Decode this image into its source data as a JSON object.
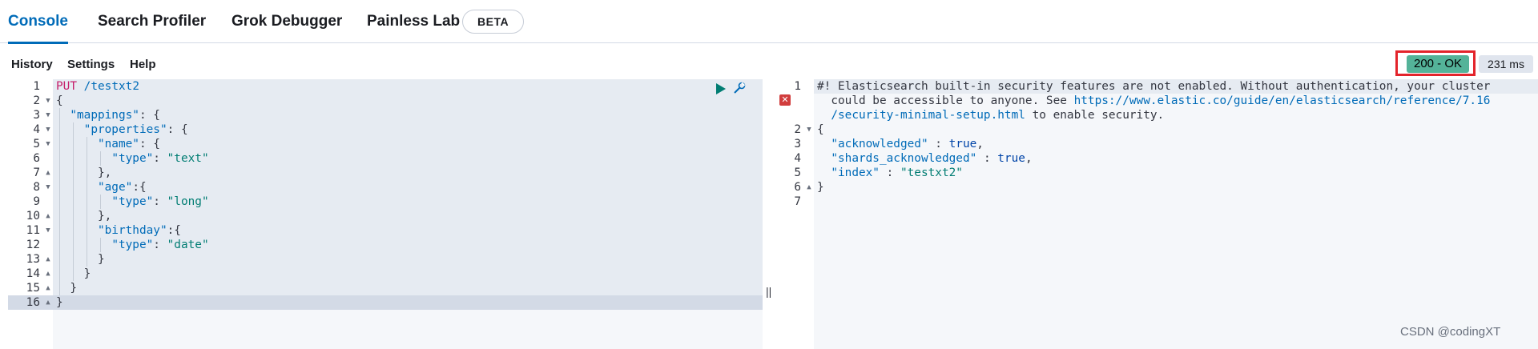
{
  "tabs": [
    {
      "label": "Console",
      "active": true
    },
    {
      "label": "Search Profiler",
      "active": false
    },
    {
      "label": "Grok Debugger",
      "active": false
    },
    {
      "label": "Painless Lab",
      "active": false
    }
  ],
  "beta_badge": "BETA",
  "toolbar": {
    "history": "History",
    "settings": "Settings",
    "help": "Help"
  },
  "response_status": {
    "status": "200 - OK",
    "status_color": "#54b399",
    "time": "231 ms"
  },
  "request_editor": {
    "line_numbers": [
      "1",
      "2",
      "3",
      "4",
      "5",
      "6",
      "7",
      "8",
      "9",
      "10",
      "11",
      "12",
      "13",
      "14",
      "15",
      "16"
    ],
    "lines": [
      "PUT /testxt2",
      "{",
      "  \"mappings\": {",
      "    \"properties\": {",
      "      \"name\": {",
      "        \"type\": \"text\"",
      "      },",
      "      \"age\":{",
      "        \"type\": \"long\"",
      "      },",
      "      \"birthday\":{",
      "        \"type\": \"date\"",
      "      }",
      "    }",
      "  }",
      "}"
    ],
    "fold_markers": [
      "",
      "▼",
      "▼",
      "▼",
      "▼",
      "",
      "▲",
      "▼",
      "",
      "▲",
      "▼",
      "",
      "▲",
      "▲",
      "▲",
      "▲"
    ]
  },
  "response_editor": {
    "line_numbers": [
      "1",
      "",
      "",
      "2",
      "3",
      "4",
      "5",
      "6",
      "7"
    ],
    "fold_markers": [
      "",
      "",
      "",
      "▼",
      "",
      "",
      "",
      "▲",
      ""
    ],
    "lines": [
      "#! Elasticsearch built-in security features are not enabled. Without authentication, your cluster",
      "  could be accessible to anyone. See https://www.elastic.co/guide/en/elasticsearch/reference/7.16",
      "  /security-minimal-setup.html to enable security.",
      "{",
      "  \"acknowledged\" : true,",
      "  \"shards_acknowledged\" : true,",
      "  \"index\" : \"testxt2\"",
      "}",
      ""
    ]
  },
  "icons": {
    "run": "play-icon",
    "settings": "wrench-icon",
    "warning": "error-icon"
  },
  "splitter": "||",
  "watermark": "CSDN @codingXT"
}
